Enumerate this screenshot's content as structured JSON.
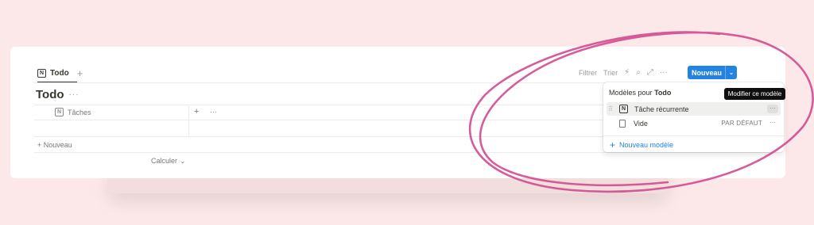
{
  "tab": {
    "label": "Todo",
    "add_symbol": "+"
  },
  "page": {
    "title": "Todo",
    "more_symbol": "···"
  },
  "table": {
    "column_header": "Tâches",
    "add_symbol": "+",
    "more_symbol": "···",
    "new_row_label": "+ Nouveau",
    "calc_label": "Calculer",
    "calc_chevron": "⌄"
  },
  "toolbar": {
    "filter": "Filtrer",
    "sort": "Trier",
    "automation_icon": "⚡",
    "search_icon": "⌕",
    "expand_icon": "⤢",
    "more_symbol": "···",
    "new_button": "Nouveau",
    "new_chevron": "⌄"
  },
  "templates_menu": {
    "heading_prefix": "Modèles pour",
    "heading_target": "Todo",
    "items": [
      {
        "label": "Tâche récurrente",
        "badge": "",
        "more_symbol": "···"
      },
      {
        "label": "Vide",
        "badge": "PAR DÉFAUT",
        "more_symbol": "···"
      }
    ],
    "new_template": "Nouveau modèle",
    "new_template_symbol": "+"
  },
  "tooltip": {
    "text": "Modifier ce modèle"
  },
  "colors": {
    "background": "#fce8e8",
    "accent": "#2383e2",
    "annotation": "#d14a8f"
  }
}
